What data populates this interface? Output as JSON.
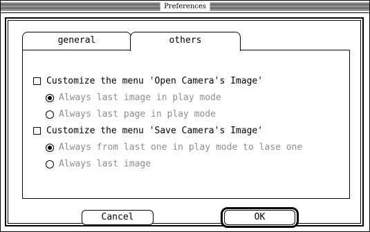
{
  "window": {
    "title": "Preferences"
  },
  "tabs": [
    {
      "label": "general",
      "selected": false
    },
    {
      "label": "others",
      "selected": true
    }
  ],
  "options": [
    {
      "type": "checkbox",
      "label": "Customize the menu 'Open Camera's Image'",
      "checked": false,
      "enabled": true
    },
    {
      "type": "radio",
      "label": "Always last image in play mode",
      "selected": true,
      "enabled": false
    },
    {
      "type": "radio",
      "label": "Always last page in play mode",
      "selected": false,
      "enabled": false
    },
    {
      "type": "checkbox",
      "label": "Customize the menu 'Save Camera's Image'",
      "checked": false,
      "enabled": true
    },
    {
      "type": "radio",
      "label": "Always from last one in play mode to lase one",
      "selected": true,
      "enabled": false
    },
    {
      "type": "radio",
      "label": "Always last image",
      "selected": false,
      "enabled": false
    }
  ],
  "buttons": {
    "cancel_label": "Cancel",
    "ok_label": "OK"
  },
  "colors": {
    "disabled_text": "#8c8c8c",
    "foreground": "#000000",
    "background": "#ffffff"
  }
}
